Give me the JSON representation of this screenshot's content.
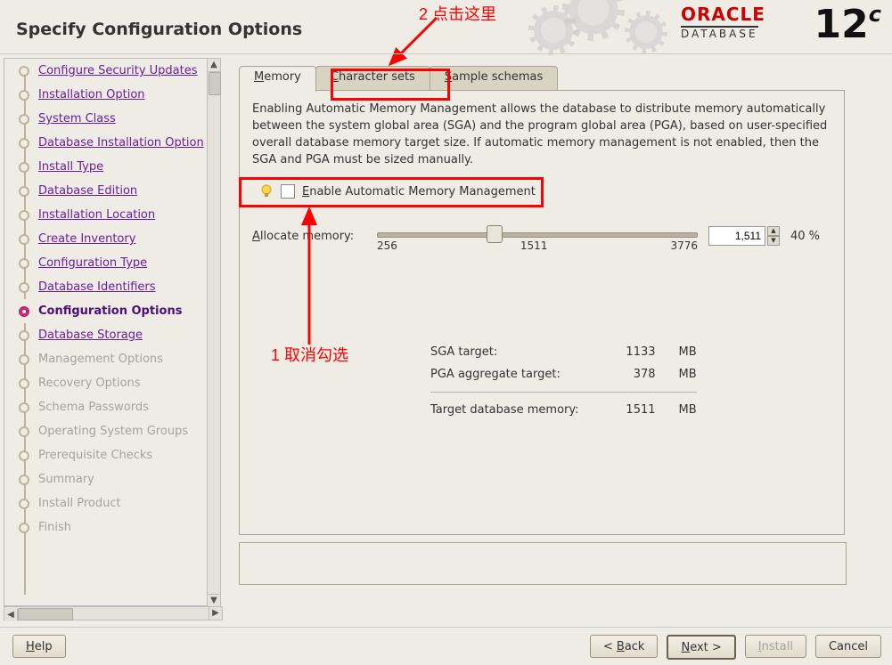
{
  "header": {
    "title": "Specify Configuration Options"
  },
  "logo": {
    "brand": "ORACLE",
    "product": "DATABASE",
    "version_main": "12",
    "version_sup": "c"
  },
  "sidebar": {
    "items": [
      {
        "label": "Configure Security Updates",
        "state": "link"
      },
      {
        "label": "Installation Option",
        "state": "link"
      },
      {
        "label": "System Class",
        "state": "link"
      },
      {
        "label": "Database Installation Option",
        "state": "link"
      },
      {
        "label": "Install Type",
        "state": "link"
      },
      {
        "label": "Database Edition",
        "state": "link"
      },
      {
        "label": "Installation Location",
        "state": "link"
      },
      {
        "label": "Create Inventory",
        "state": "link"
      },
      {
        "label": "Configuration Type",
        "state": "link"
      },
      {
        "label": "Database Identifiers",
        "state": "link"
      },
      {
        "label": "Configuration Options",
        "state": "current"
      },
      {
        "label": "Database Storage",
        "state": "link"
      },
      {
        "label": "Management Options",
        "state": "disabled"
      },
      {
        "label": "Recovery Options",
        "state": "disabled"
      },
      {
        "label": "Schema Passwords",
        "state": "disabled"
      },
      {
        "label": "Operating System Groups",
        "state": "disabled"
      },
      {
        "label": "Prerequisite Checks",
        "state": "disabled"
      },
      {
        "label": "Summary",
        "state": "disabled"
      },
      {
        "label": "Install Product",
        "state": "disabled"
      },
      {
        "label": "Finish",
        "state": "disabled"
      }
    ]
  },
  "tabs": [
    {
      "label": "Memory",
      "mnemonic": "M",
      "active": true
    },
    {
      "label": "Character sets",
      "mnemonic": "C",
      "active": false
    },
    {
      "label": "Sample schemas",
      "mnemonic": "S",
      "active": false
    }
  ],
  "memory": {
    "description": "Enabling Automatic Memory Management allows the database to distribute memory automatically between the system global area (SGA) and the program global area (PGA), based on user-specified overall database memory target size. If automatic memory management is not enabled, then the SGA and PGA must be sized manually.",
    "checkbox_label": "Enable Automatic Memory Management",
    "checkbox_mnemonic": "E",
    "checkbox_checked": false,
    "allocate_label": "Allocate memory:",
    "allocate_mnemonic": "A",
    "slider": {
      "min": 256,
      "mid": 1511,
      "max": 3776,
      "value": 1511
    },
    "spinner_value": "1,511",
    "percent_label": "40 %",
    "table": {
      "rows": [
        {
          "label": "SGA target:",
          "value": 1133,
          "unit": "MB"
        },
        {
          "label": "PGA aggregate target:",
          "value": 378,
          "unit": "MB"
        }
      ],
      "total": {
        "label": "Target database memory:",
        "value": 1511,
        "unit": "MB"
      }
    }
  },
  "annotations": {
    "top_text": "2 点击这里",
    "bottom_text": "1 取消勾选"
  },
  "footer": {
    "help": "Help",
    "back": "< Back",
    "next": "Next >",
    "install": "Install",
    "cancel": "Cancel"
  },
  "colors": {
    "accent_red": "#ff0000",
    "link_purple": "#6a1f9e",
    "oracle_red": "#c00"
  }
}
